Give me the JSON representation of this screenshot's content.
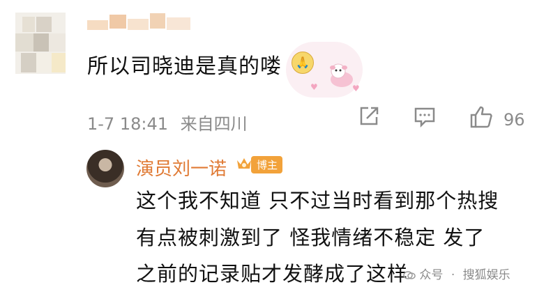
{
  "comment": {
    "text": "所以司晓迪是真的喽",
    "time": "1-7 18:41",
    "location": "来自四川",
    "like_count": "96"
  },
  "reply": {
    "author": "演员刘一诺",
    "badge": "博主",
    "lines": [
      "这个我不知道 只不过当时看到那个热搜",
      "有点被刺激到了 怪我情绪不稳定 发了",
      "之前的记录贴才发酵成了这样"
    ]
  },
  "watermark": {
    "partial": "众号",
    "separator": "·",
    "source": "搜狐娱乐"
  },
  "icons": [
    "share-icon",
    "comment-icon",
    "like-icon",
    "crown-icon",
    "pixelated-avatar",
    "emoji-icon",
    "sticker-icon"
  ],
  "colors": {
    "author": "#e07a34",
    "badge": "#f2a23a",
    "meta": "#8a8a8a"
  }
}
